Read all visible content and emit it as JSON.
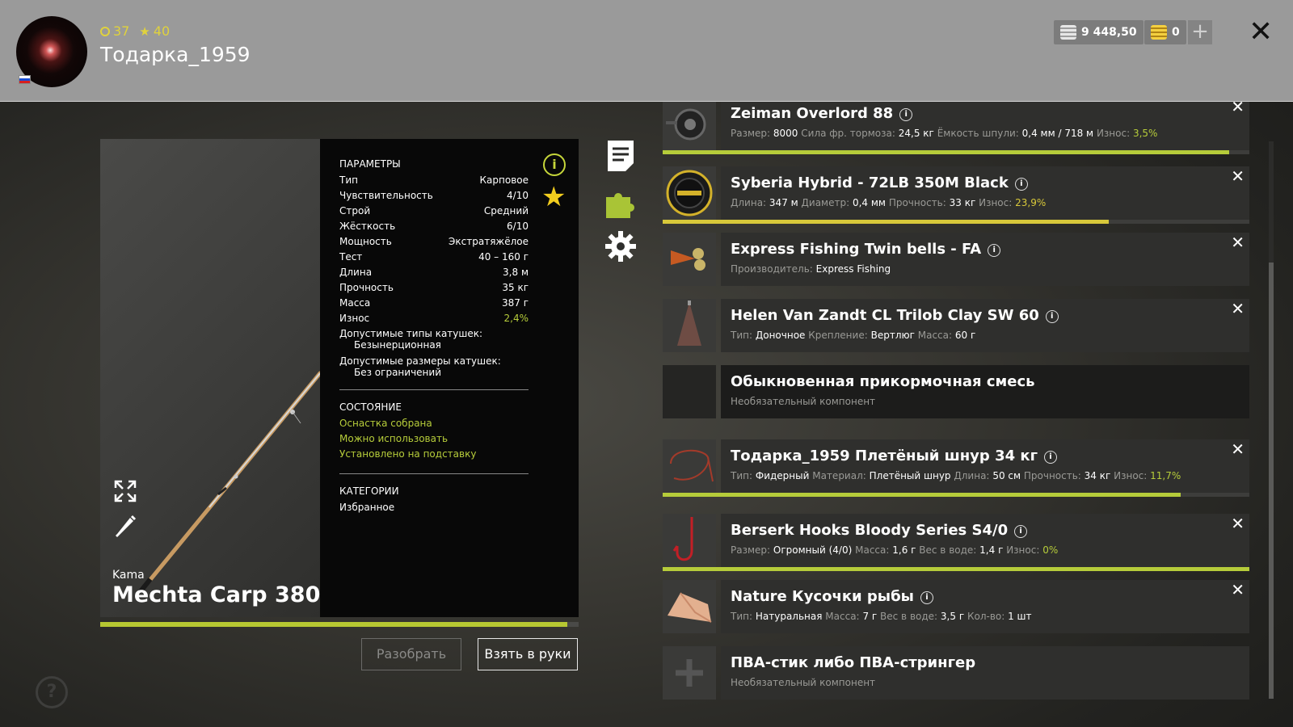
{
  "header": {
    "level": "37",
    "rank": "40",
    "username": "Тодарка_1959",
    "silver": "9 448,50",
    "gold": "0"
  },
  "rod": {
    "brand": "Kama",
    "name": "Mechta Carp 380",
    "wear_fraction": 0.976
  },
  "params": {
    "title": "ПАРАМЕТРЫ",
    "rows": [
      {
        "label": "Тип",
        "value": "Карповое"
      },
      {
        "label": "Чувствительность",
        "value": "4/10"
      },
      {
        "label": "Строй",
        "value": "Средний"
      },
      {
        "label": "Жёсткость",
        "value": "6/10"
      },
      {
        "label": "Мощность",
        "value": "Экстратяжёлое"
      },
      {
        "label": "Тест",
        "value": "40 – 160 г"
      },
      {
        "label": "Длина",
        "value": "3,8 м"
      },
      {
        "label": "Прочность",
        "value": "35 кг"
      },
      {
        "label": "Масса",
        "value": "387 г"
      },
      {
        "label": "Износ",
        "value": "2,4%"
      }
    ],
    "reel_types_label": "Допустимые типы катушек:",
    "reel_types_value": "Безынерционная",
    "reel_sizes_label": "Допустимые размеры катушек:",
    "reel_sizes_value": "Без ограничений",
    "state_title": "СОСТОЯНИЕ",
    "states": [
      "Оснастка собрана",
      "Можно использовать",
      "Установлено на подставку"
    ],
    "categories_title": "КАТЕГОРИИ",
    "categories": "Избранное"
  },
  "buttons": {
    "disassemble": "Разобрать",
    "take": "Взять в руки",
    "help": "?"
  },
  "colors": {
    "accent_green": "#b6cc3a",
    "accent_yellow": "#d8c83a",
    "header_bg": "#9a9a9a"
  },
  "items": [
    {
      "title": "Zeiman Overlord 88",
      "specs": [
        {
          "label": "Размер:",
          "value": "8000"
        },
        {
          "label": "Сила фр. тормоза:",
          "value": "24,5 кг"
        },
        {
          "label": "Ёмкость шпули:",
          "value": "0,4 мм / 718 м"
        },
        {
          "label": "Износ:",
          "value": "3,5%",
          "tone": "green"
        }
      ],
      "progress": 0.965
    },
    {
      "title": "Syberia Hybrid - 72LB 350M Black",
      "specs": [
        {
          "label": "Длина:",
          "value": "347 м"
        },
        {
          "label": "Диаметр:",
          "value": "0,4 мм"
        },
        {
          "label": "Прочность:",
          "value": "33 кг"
        },
        {
          "label": "Износ:",
          "value": "23,9%",
          "tone": "yellow"
        }
      ],
      "progress": 0.761
    },
    {
      "title": "Express Fishing Twin bells - FA",
      "specs": [
        {
          "label": "Производитель:",
          "value": "Express Fishing"
        }
      ]
    },
    {
      "title": "Helen Van Zandt CL Trilob Clay SW 60",
      "specs": [
        {
          "label": "Тип:",
          "value": "Доночное"
        },
        {
          "label": "Крепление:",
          "value": "Вертлюг"
        },
        {
          "label": "Масса:",
          "value": "60 г"
        }
      ]
    },
    {
      "title": "Обыкновенная прикормочная смесь",
      "note": "Необязательный компонент"
    },
    {
      "title": "Тодарка_1959 Плетёный шнур 34 кг",
      "specs": [
        {
          "label": "Тип:",
          "value": "Фидерный"
        },
        {
          "label": "Материал:",
          "value": "Плетёный шнур"
        },
        {
          "label": "Длина:",
          "value": "50 см"
        },
        {
          "label": "Прочность:",
          "value": "34 кг"
        },
        {
          "label": "Износ:",
          "value": "11,7%",
          "tone": "green"
        }
      ],
      "progress": 0.883
    },
    {
      "title": "Berserk Hooks Bloody Series S4/0",
      "specs": [
        {
          "label": "Размер:",
          "value": "Огромный (4/0)"
        },
        {
          "label": "Масса:",
          "value": "1,6 г"
        },
        {
          "label": "Вес в воде:",
          "value": "1,4 г"
        },
        {
          "label": "Износ:",
          "value": "0%",
          "tone": "green"
        }
      ],
      "progress": 1.0
    },
    {
      "title": "Nature Кусочки рыбы",
      "specs": [
        {
          "label": "Тип:",
          "value": "Натуральная"
        },
        {
          "label": "Масса:",
          "value": "7 г"
        },
        {
          "label": "Вес в воде:",
          "value": "3,5 г"
        },
        {
          "label": "Кол-во:",
          "value": "1 шт"
        }
      ]
    },
    {
      "title": "ПВА-стик либо ПВА-стрингер",
      "note": "Необязательный компонент"
    }
  ]
}
